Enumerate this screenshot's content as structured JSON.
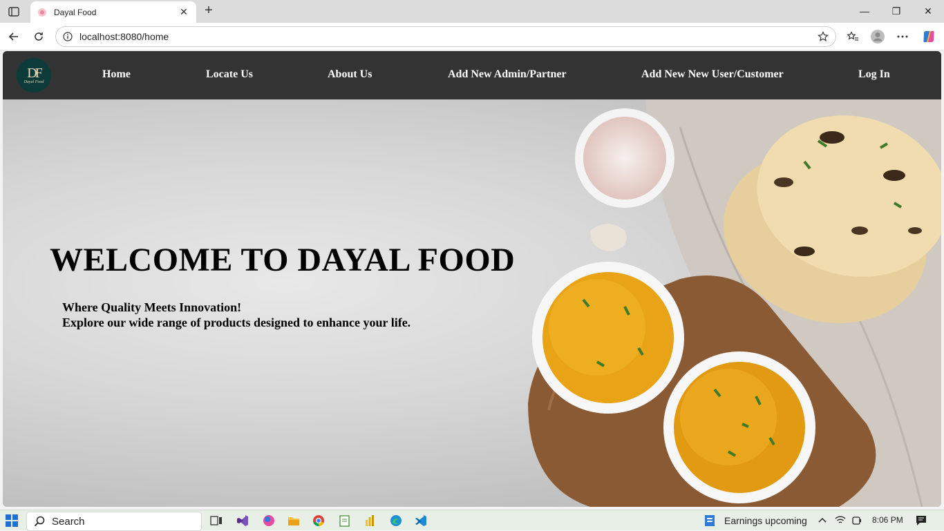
{
  "browser": {
    "tab_title": "Dayal Food",
    "url": "localhost:8080/home",
    "tab_close_glyph": "✕",
    "new_tab_glyph": "+",
    "minimize_glyph": "—",
    "maximize_glyph": "❐",
    "close_glyph": "✕"
  },
  "site": {
    "logo_mark": "DF",
    "logo_sub": "Dayal Food",
    "nav": {
      "home": "Home",
      "locate": "Locate Us",
      "about": "About Us",
      "add_admin": "Add New Admin/Partner",
      "add_user": "Add New New User/Customer",
      "login": "Log In"
    },
    "hero": {
      "title": "WELCOME TO DAYAL FOOD",
      "line1": "Where Quality Meets Innovation!",
      "line2": "Explore our wide range of products designed to enhance your life."
    }
  },
  "taskbar": {
    "search_label": "Search",
    "news": "Earnings upcoming",
    "time": "8:06 PM"
  },
  "colors": {
    "nav_bg": "#333333",
    "logo_bg": "#0d3b3a",
    "rice": "#e8a317"
  }
}
